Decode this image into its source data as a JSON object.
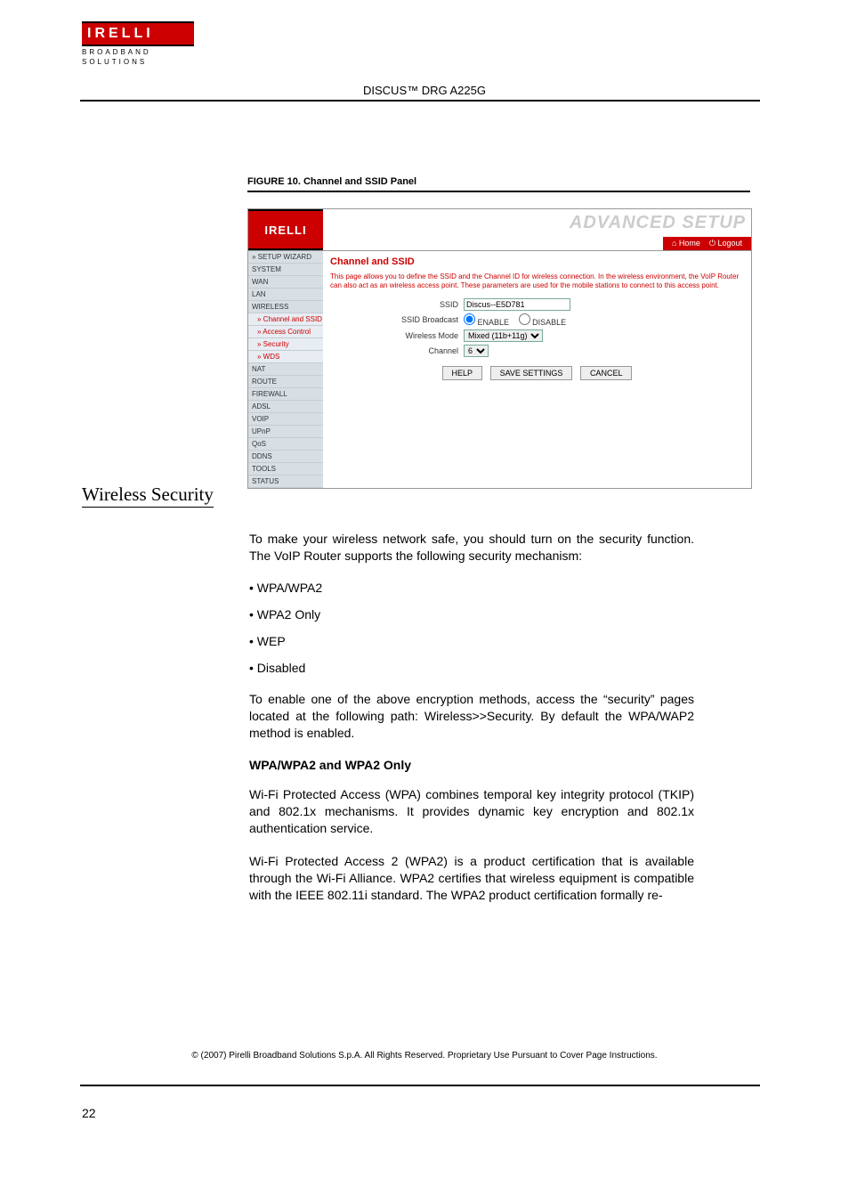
{
  "logo": {
    "brand": "IRELLI",
    "sub1": "BROADBAND",
    "sub2": "SOLUTIONS"
  },
  "product_title": "DISCUS™ DRG A225G",
  "figure": {
    "label": "FIGURE 10.",
    "title": "Channel and SSID Panel"
  },
  "panel": {
    "brand": "IRELLI",
    "advanced": "ADVANCED SETUP",
    "tab_home": "Home",
    "tab_logout": "Logout",
    "sidebar": [
      "» SETUP WIZARD",
      "SYSTEM",
      "WAN",
      "LAN",
      "WIRELESS",
      "  » Channel and SSID",
      "  » Access Control",
      "  » Security",
      "  » WDS",
      "NAT",
      "ROUTE",
      "FIREWALL",
      "ADSL",
      "VOIP",
      "UPnP",
      "QoS",
      "DDNS",
      "TOOLS",
      "STATUS"
    ],
    "content": {
      "title": "Channel and SSID",
      "desc": "This page allows you to define the SSID and the Channel ID for wireless connection. In the wireless environment, the VoIP Router can also act as an wireless access point. These parameters are used for the mobile stations to connect to this access point.",
      "ssid_label": "SSID",
      "ssid_value": "Discus--E5D781",
      "broadcast_label": "SSID Broadcast",
      "broadcast_enable": "ENABLE",
      "broadcast_disable": "DISABLE",
      "mode_label": "Wireless Mode",
      "mode_value": "Mixed (11b+11g)",
      "channel_label": "Channel",
      "channel_value": "6",
      "btn_help": "HELP",
      "btn_save": "SAVE SETTINGS",
      "btn_cancel": "CANCEL"
    }
  },
  "section_heading": "Wireless Security",
  "body": {
    "p1": "To make your wireless network safe, you should turn on the security function. The VoIP Router supports the following security mechanism:",
    "li1": "WPA/WPA2",
    "li2": "WPA2 Only",
    "li3": "WEP",
    "li4": "Disabled",
    "p2": "To enable one of the above encryption methods, access the “security” pages located at the following path: Wireless>>Security. By default the WPA/WAP2 method is enabled.",
    "subhead": "WPA/WPA2 and WPA2 Only",
    "p3": "Wi-Fi Protected Access (WPA) combines temporal key integrity protocol (TKIP) and 802.1x mechanisms. It provides dynamic key encryption and 802.1x authentication service.",
    "p4": "Wi-Fi Protected Access 2 (WPA2) is a product certification that is available through the Wi-Fi Alliance. WPA2 certifies that wireless equipment is compatible with the IEEE 802.11i standard. The WPA2 product certification formally re-"
  },
  "footer": "© (2007) Pirelli Broadband Solutions S.p.A. All Rights Reserved. Proprietary Use Pursuant to Cover Page Instructions.",
  "page_number": "22"
}
